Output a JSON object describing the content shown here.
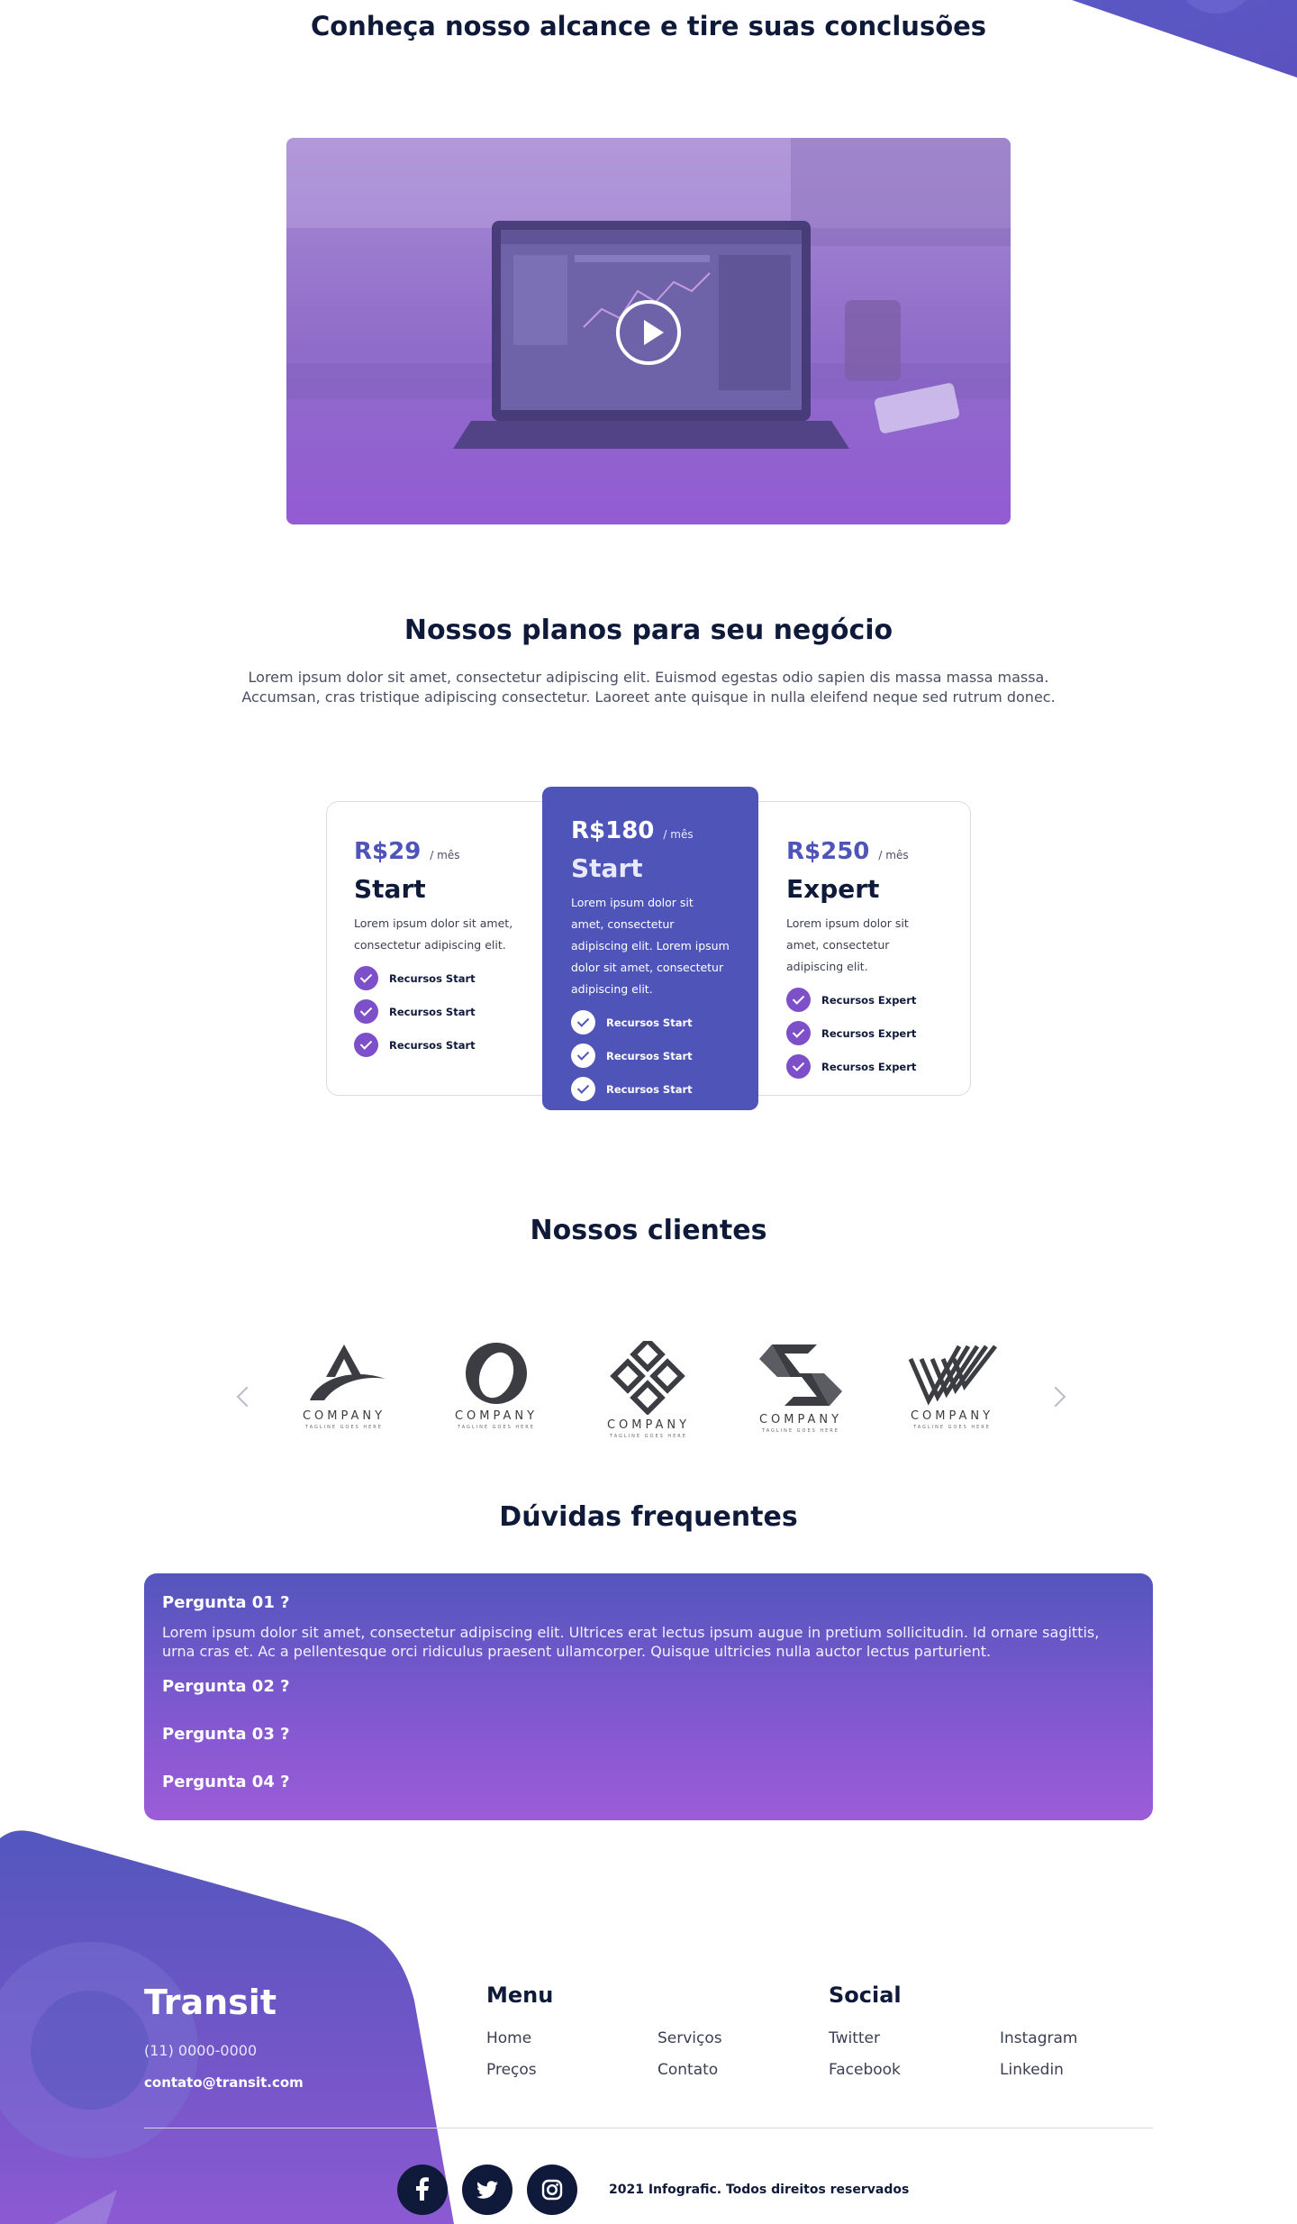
{
  "sections": {
    "reach_title": "Conheça nosso alcance e tire suas conclusões",
    "plans_title": "Nossos planos para seu negócio",
    "plans_description": "Lorem ipsum dolor sit amet, consectetur adipiscing elit. Euismod egestas odio sapien dis massa massa massa. Accumsan, cras tristique adipiscing consectetur. Laoreet ante quisque in nulla eleifend neque sed rutrum donec.",
    "clients_title": "Nossos clientes",
    "faq_title": "Dúvidas frequentes"
  },
  "video": {
    "play_icon": "play-icon"
  },
  "plans": [
    {
      "price": "R$29",
      "period": "/ mês",
      "name": "Start",
      "description": "Lorem ipsum dolor sit amet, consectetur adipiscing elit.",
      "features": [
        "Recursos Start",
        "Recursos Start",
        "Recursos Start"
      ]
    },
    {
      "price": "R$180",
      "period": "/ mês",
      "name": "Start",
      "description": "Lorem ipsum dolor sit amet, consectetur adipiscing elit. Lorem ipsum dolor sit amet, consectetur adipiscing elit.",
      "features": [
        "Recursos Start",
        "Recursos Start",
        "Recursos Start"
      ]
    },
    {
      "price": "R$250",
      "period": "/ mês",
      "name": "Expert",
      "description": "Lorem ipsum dolor sit amet, consectetur adipiscing elit.",
      "features": [
        "Recursos Expert",
        "Recursos Expert",
        "Recursos Expert"
      ]
    }
  ],
  "clients": {
    "logos": [
      {
        "name": "COMPANY",
        "tagline": "TAGLINE GOES HERE"
      },
      {
        "name": "COMPANY",
        "tagline": "TAGLINE GOES HERE"
      },
      {
        "name": "COMPANY",
        "tagline": "TAGLINE GOES HERE"
      },
      {
        "name": "COMPANY",
        "tagline": "TAGLINE GOES HERE"
      },
      {
        "name": "COMPANY",
        "tagline": "TAGLINE GOES HERE"
      }
    ]
  },
  "faq": {
    "items": [
      {
        "question": "Pergunta 01 ?",
        "answer": "Lorem ipsum dolor sit amet, consectetur adipiscing elit. Ultrices erat lectus ipsum augue in pretium sollicitudin. Id ornare sagittis, urna cras et. Ac a pellentesque orci ridiculus praesent ullamcorper. Quisque ultricies nulla auctor lectus parturient."
      },
      {
        "question": "Pergunta 02 ?"
      },
      {
        "question": "Pergunta 03 ?"
      },
      {
        "question": "Pergunta 04 ?"
      }
    ]
  },
  "footer": {
    "brand": "Transit",
    "phone": "(11) 0000-0000",
    "email": "contato@transit.com",
    "menu_title": "Menu",
    "menu_links": [
      "Home",
      "Serviços",
      "Preços",
      "Contato"
    ],
    "social_title": "Social",
    "social_links": [
      "Twitter",
      "Instagram",
      "Facebook",
      "Linkedin"
    ],
    "social_icons": [
      "facebook-icon",
      "twitter-icon",
      "instagram-icon"
    ],
    "copyright": "2021 Infografic. Todos direitos reservados"
  },
  "colors": {
    "primary": "#4f55b8",
    "accent": "#7d50c9",
    "dark": "#0f1a3a"
  }
}
